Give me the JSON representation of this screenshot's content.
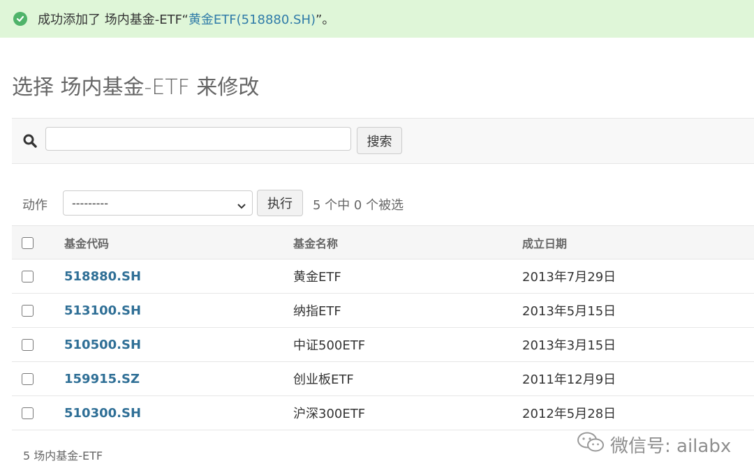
{
  "message": {
    "prefix": "成功添加了 场内基金-ETF“",
    "link": "黄金ETF(518880.SH)",
    "suffix": "”。"
  },
  "page_title": "选择 场内基金-ETF 来修改",
  "search": {
    "value": "",
    "placeholder": "",
    "button_label": "搜索"
  },
  "actions": {
    "label": "动作",
    "selected": "---------",
    "run_label": "执行",
    "counter": "5 个中 0 个被选"
  },
  "table": {
    "headers": [
      "基金代码",
      "基金名称",
      "成立日期"
    ],
    "rows": [
      {
        "code": "518880.SH",
        "name": "黄金ETF",
        "date": "2013年7月29日"
      },
      {
        "code": "513100.SH",
        "name": "纳指ETF",
        "date": "2013年5月15日"
      },
      {
        "code": "510500.SH",
        "name": "中证500ETF",
        "date": "2013年3月15日"
      },
      {
        "code": "159915.SZ",
        "name": "创业板ETF",
        "date": "2011年12月9日"
      },
      {
        "code": "510300.SH",
        "name": "沪深300ETF",
        "date": "2012年5月28日"
      }
    ]
  },
  "paginator": "5 场内基金-ETF",
  "watermark": "微信号: ailabx",
  "colors": {
    "success_bg": "#dff6d8",
    "link": "#2f6f96",
    "success_icon": "#4fb36a"
  }
}
